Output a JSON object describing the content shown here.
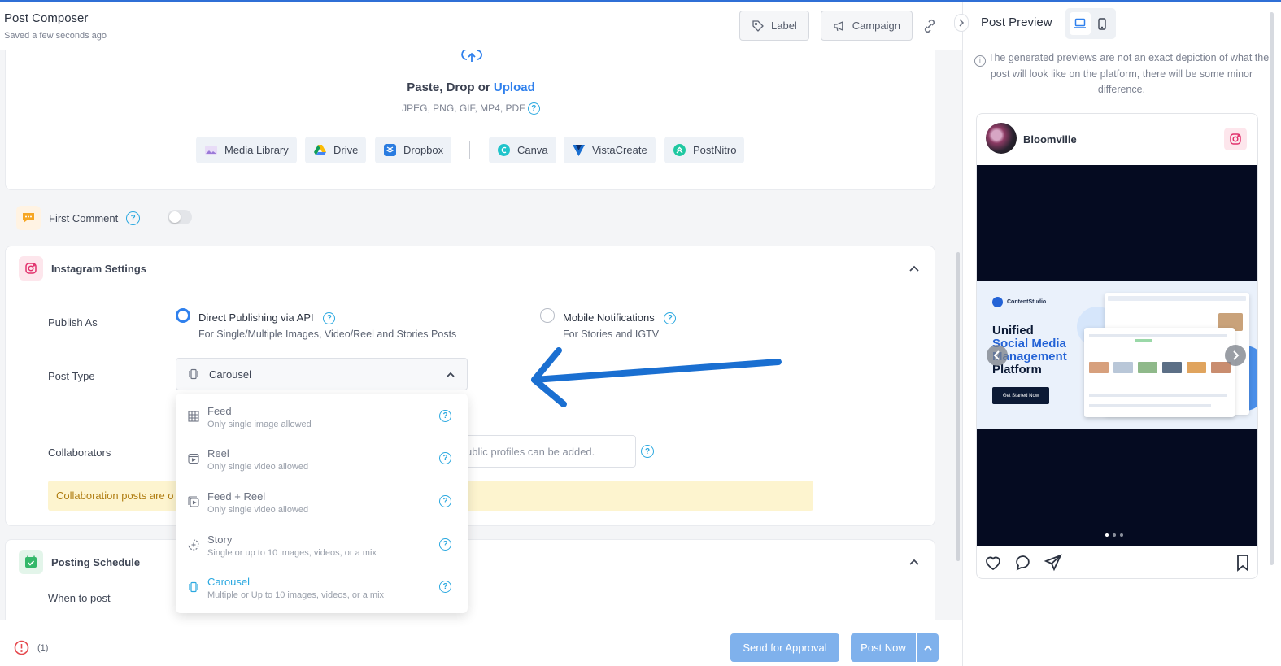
{
  "header": {
    "title": "Post Composer",
    "saved_status": "Saved a few seconds ago",
    "label_button": "Label",
    "campaign_button": "Campaign"
  },
  "upload": {
    "paste_drop": "Paste, Drop or",
    "upload_link": "Upload",
    "formats": "JPEG, PNG, GIF, MP4, PDF",
    "sources": [
      "Media Library",
      "Drive",
      "Dropbox",
      "Canva",
      "VistaCreate",
      "PostNitro"
    ]
  },
  "first_comment": {
    "label": "First Comment",
    "enabled": false
  },
  "instagram_settings": {
    "title": "Instagram Settings",
    "publish_as_label": "Publish As",
    "options": [
      {
        "title": "Direct Publishing via API",
        "subtitle": "For Single/Multiple Images, Video/Reel and Stories Posts",
        "selected": true
      },
      {
        "title": "Mobile Notifications",
        "subtitle": "For Stories and IGTV",
        "selected": false
      }
    ],
    "post_type_label": "Post Type",
    "post_type_value": "Carousel",
    "collaborators_label": "Collaborators",
    "collaborators_placeholder": "ublic profiles can be added.",
    "collab_warning": "Collaboration posts are o"
  },
  "post_type_menu": [
    {
      "title": "Feed",
      "subtitle": "Only single image allowed",
      "icon": "grid-icon",
      "selected": false
    },
    {
      "title": "Reel",
      "subtitle": "Only single video allowed",
      "icon": "reel-icon",
      "selected": false
    },
    {
      "title": "Feed + Reel",
      "subtitle": "Only single video allowed",
      "icon": "feed-reel-icon",
      "selected": false
    },
    {
      "title": "Story",
      "subtitle": "Single or up to 10 images, videos, or a mix",
      "icon": "story-icon",
      "selected": false
    },
    {
      "title": "Carousel",
      "subtitle": "Multiple or Up to 10 images, videos, or a mix",
      "icon": "carousel-icon",
      "selected": true
    }
  ],
  "posting_schedule": {
    "title": "Posting Schedule",
    "when_label": "When to post"
  },
  "footer": {
    "error_count": "(1)",
    "send_approval": "Send for Approval",
    "post_now": "Post Now"
  },
  "preview": {
    "title": "Post Preview",
    "note": "The generated previews are not an exact depiction of what the post will look like on the platform, there will be some minor difference.",
    "account_name": "Bloomville",
    "banner": {
      "brand": "ContentStudio",
      "line1": "Unified",
      "line2": "Social Media",
      "line3": "Management",
      "line4": "Platform",
      "cta": "Get Started Now"
    },
    "carousel_slides": 3,
    "current_slide": 1
  },
  "colors": {
    "accent": "#2f80ed",
    "arrow": "#1a6fd1",
    "warning_bg": "#fdf4cf",
    "primary_button": "#7fb1ec"
  }
}
